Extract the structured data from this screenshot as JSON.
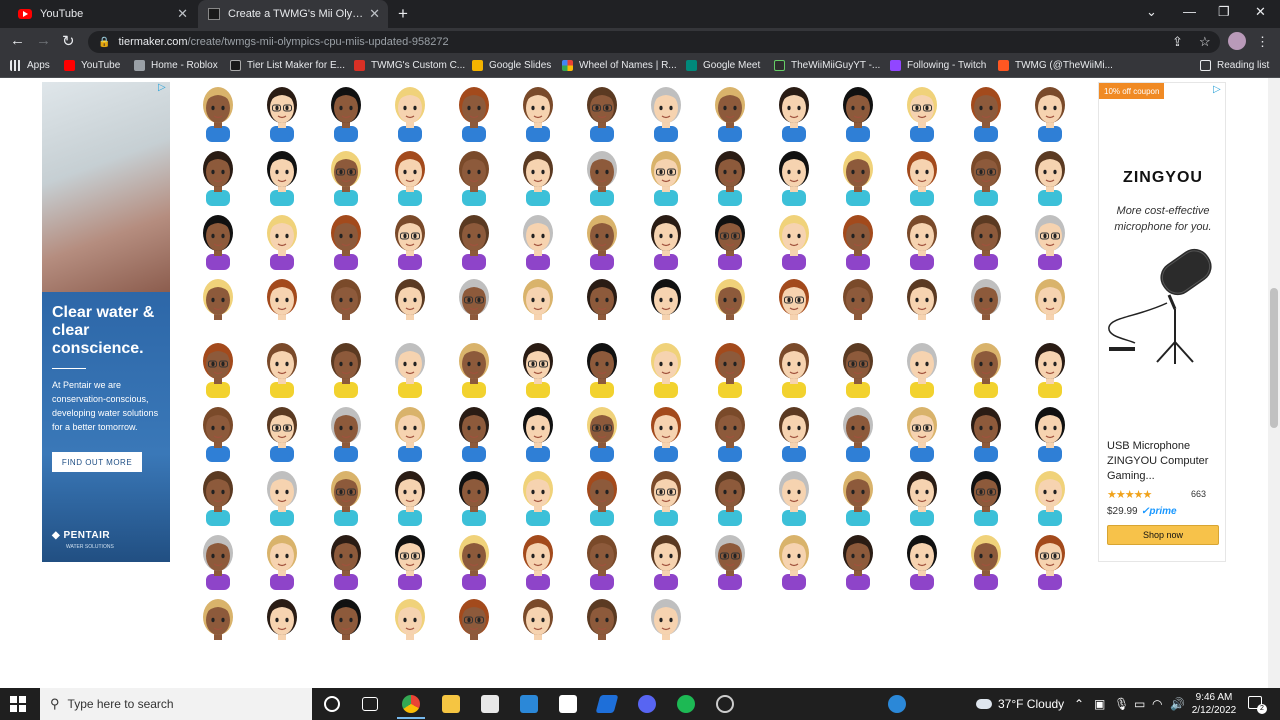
{
  "browser": {
    "tabs": [
      {
        "title": "YouTube",
        "icon": "youtube-icon"
      },
      {
        "title": "Create a TWMG's Mii Olympics CPU Miis (updated) Tier List - TierMaker",
        "icon": "tiermaker-icon"
      }
    ],
    "url": {
      "host": "tiermaker.com",
      "path": "/create/twmgs-mii-olympics-cpu-miis-updated-958272"
    },
    "bookmarks": [
      {
        "label": "Apps",
        "color": "#e8eaed"
      },
      {
        "label": "YouTube",
        "color": "#ff0000"
      },
      {
        "label": "Home - Roblox",
        "color": "#9aa0a6"
      },
      {
        "label": "Tier List Maker for E...",
        "color": "#1a1a1a"
      },
      {
        "label": "TWMG's Custom C...",
        "color": "#d93025"
      },
      {
        "label": "Google Slides",
        "color": "#f4b400"
      },
      {
        "label": "Wheel of Names | R...",
        "color": "#34a853"
      },
      {
        "label": "Google Meet",
        "color": "#00897b"
      },
      {
        "label": "TheWiiMiiGuyYT -...",
        "color": "#2d2d2d"
      },
      {
        "label": "Following - Twitch",
        "color": "#9146ff"
      },
      {
        "label": "TWMG (@TheWiiMi...",
        "color": "#ff5722"
      }
    ],
    "reading_list": "Reading list"
  },
  "ad_left": {
    "headline": "Clear water & clear conscience.",
    "copy": "At Pentair we are conservation-conscious, developing water solutions for a better tomorrow.",
    "cta": "FIND OUT MORE",
    "brand": "PENTAIR",
    "brand_sub": "WATER SOLUTIONS"
  },
  "ad_right": {
    "coupon": "10% off coupon",
    "logo": "ZINGYOU",
    "tagline": "More cost-effective microphone for you.",
    "product_title": "USB Microphone ZINGYOU Computer Gaming...",
    "stars": "★★★★★",
    "rating": 4.5,
    "review_count": "663",
    "price": "$29.99",
    "prime": "✓prime",
    "shop_label": "Shop now"
  },
  "mii_grid": {
    "columns": 14,
    "row_counts": [
      14,
      14,
      14,
      14,
      14,
      14,
      14,
      14,
      8
    ],
    "total": 120
  },
  "taskbar": {
    "search_placeholder": "Type here to search",
    "weather": "37°F  Cloudy",
    "time": "9:46 AM",
    "date": "2/12/2022",
    "notification_count": "2"
  }
}
